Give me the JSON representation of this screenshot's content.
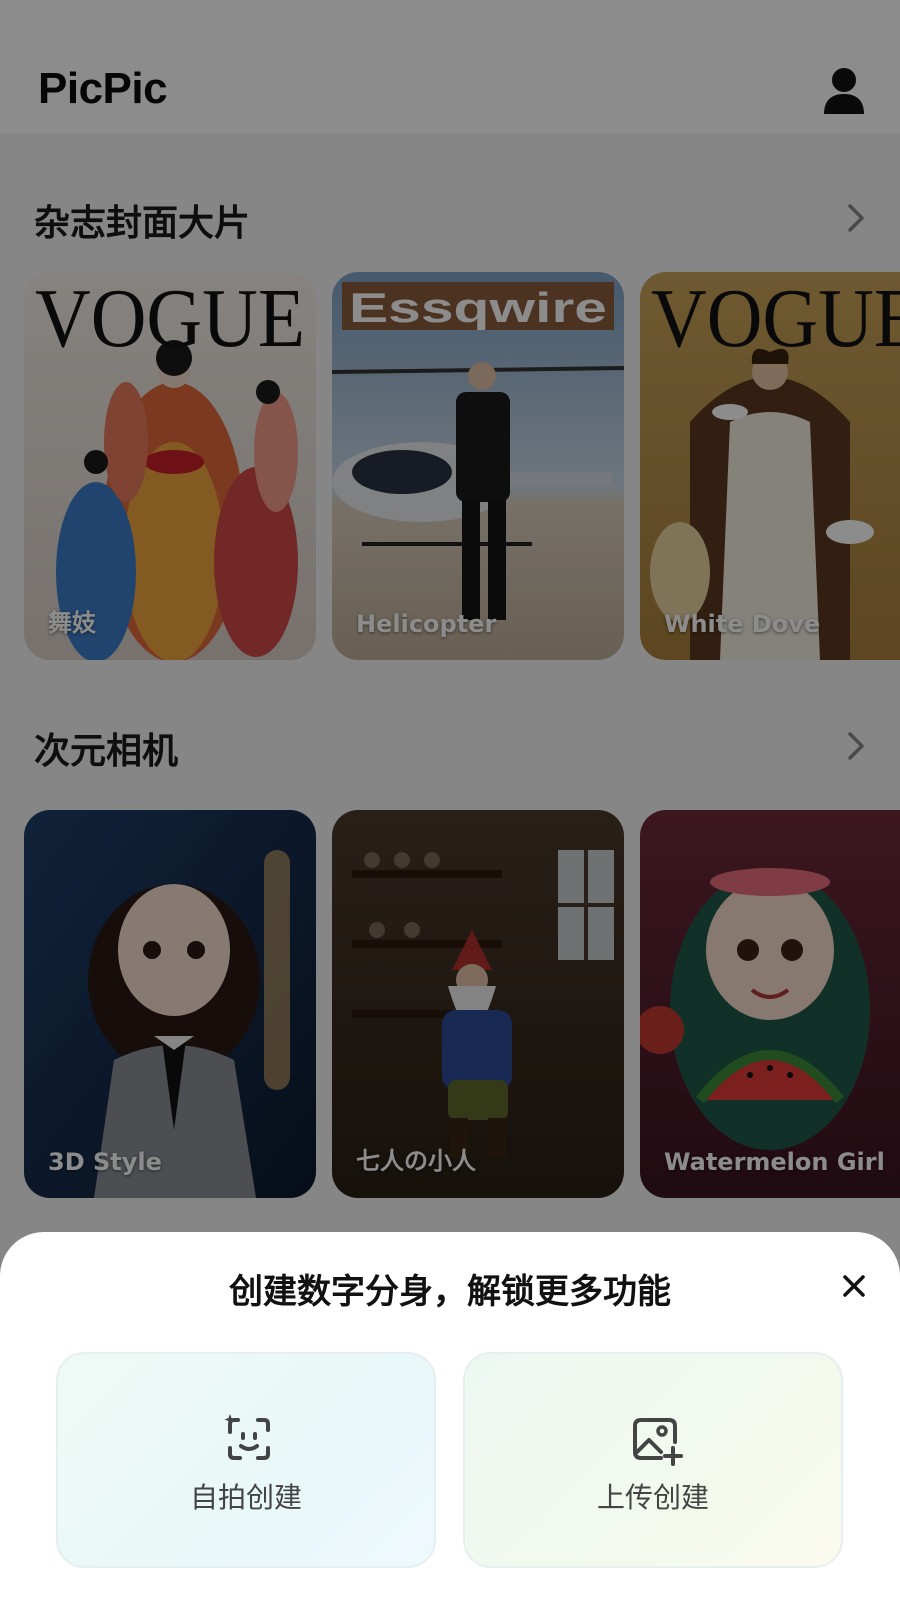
{
  "app": {
    "title": "PicPic"
  },
  "sections": [
    {
      "title": "杂志封面大片",
      "cards": [
        {
          "label": "舞妓",
          "cover_text": "VOGUE"
        },
        {
          "label": "Helicopter",
          "cover_text": "Essqwire"
        },
        {
          "label": "White Dove",
          "cover_text": "VOGUE"
        }
      ]
    },
    {
      "title": "次元相机",
      "cards": [
        {
          "label": "3D Style"
        },
        {
          "label": "七人の小人"
        },
        {
          "label": "Watermelon Girl"
        }
      ]
    }
  ],
  "sheet": {
    "title": "创建数字分身，解锁更多功能",
    "options": [
      {
        "label": "自拍创建",
        "icon": "face-scan-icon"
      },
      {
        "label": "上传创建",
        "icon": "image-add-icon"
      }
    ]
  },
  "colors": {
    "overlay": "rgba(0,0,0,0.45)",
    "sheet_bg": "#ffffff",
    "selfie_tint": "#eaf8f6",
    "upload_tint": "#f3f9ee"
  }
}
